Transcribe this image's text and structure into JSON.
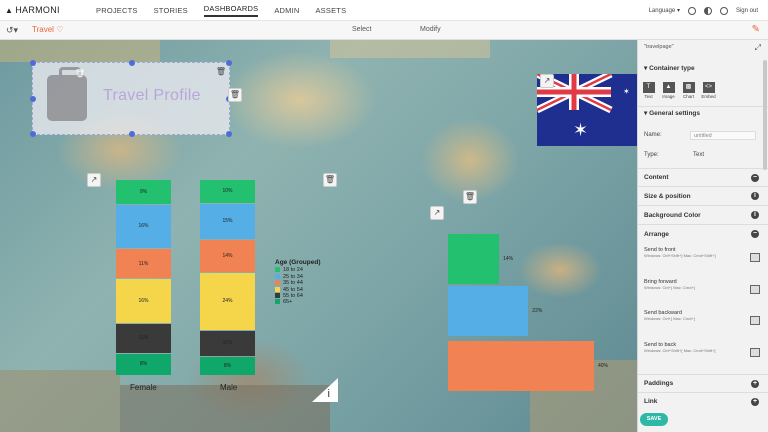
{
  "app": {
    "logo": "HARMONI"
  },
  "nav": {
    "items": [
      "PROJECTS",
      "STORIES",
      "DASHBOARDS",
      "ADMIN",
      "ASSETS"
    ],
    "active": "DASHBOARDS"
  },
  "topright": {
    "language": "Language",
    "signout": "Sign out"
  },
  "toolbar": {
    "title": "Travel ♡",
    "select": "Select",
    "modify": "Modify"
  },
  "profile": {
    "title": "Travel Profile"
  },
  "chart_data": {
    "type": "bar",
    "categories": [
      "Female",
      "Male"
    ],
    "legend_title": "Age (Grouped)",
    "legend_position": "right",
    "series": [
      {
        "name": "18 to 24",
        "color": "#22c06f",
        "values": [
          9,
          10
        ]
      },
      {
        "name": "25 to 34",
        "color": "#55aee6",
        "values": [
          16,
          15
        ]
      },
      {
        "name": "35 to 44",
        "color": "#f08253",
        "values": [
          11,
          14
        ]
      },
      {
        "name": "45 to 54",
        "color": "#f5d54a",
        "values": [
          16,
          24
        ]
      },
      {
        "name": "55 to 64",
        "color": "#3a3a3a",
        "values": [
          11,
          11
        ]
      },
      {
        "name": "65+",
        "color": "#0fa86a",
        "values": [
          8,
          8
        ]
      }
    ],
    "bar_labels": {
      "Female": [
        "9%",
        "16%",
        "11%",
        "16%",
        "11%",
        "8%"
      ],
      "Male": [
        "10%",
        "15%",
        "14%",
        "24%",
        "11%",
        "8%"
      ]
    }
  },
  "chart2": {
    "type": "bar",
    "orientation": "horizontal",
    "values": [
      14,
      22,
      40
    ],
    "labels": [
      "14%",
      "22%",
      "40%"
    ],
    "colors": [
      "#22c06f",
      "#55aee6",
      "#f08253"
    ]
  },
  "panel": {
    "header": "\"travelpage\"",
    "container_type": "Container type",
    "types": [
      "Text",
      "Image",
      "Chart",
      "Embed"
    ],
    "general": "General settings",
    "name_label": "Name:",
    "name_value": "untitled",
    "type_label": "Type:",
    "type_value": "Text",
    "sections": [
      "Content",
      "Size & position",
      "Background Color",
      "Arrange"
    ],
    "arrange": [
      {
        "title": "Send to front",
        "sub": "Windows: Ctrl+Shift+]  Mac: Cmd+Shift+]"
      },
      {
        "title": "Bring forward",
        "sub": "Windows: Ctrl+]  Mac: Cmd+]"
      },
      {
        "title": "Send backward",
        "sub": "Windows: Ctrl+[  Mac: Cmd+["
      },
      {
        "title": "Send to back",
        "sub": "Windows: Ctrl+Shift+[  Mac: Cmd+Shift+["
      }
    ],
    "bottom_sections": [
      "Paddings",
      "Link"
    ],
    "save": "SAVE"
  }
}
